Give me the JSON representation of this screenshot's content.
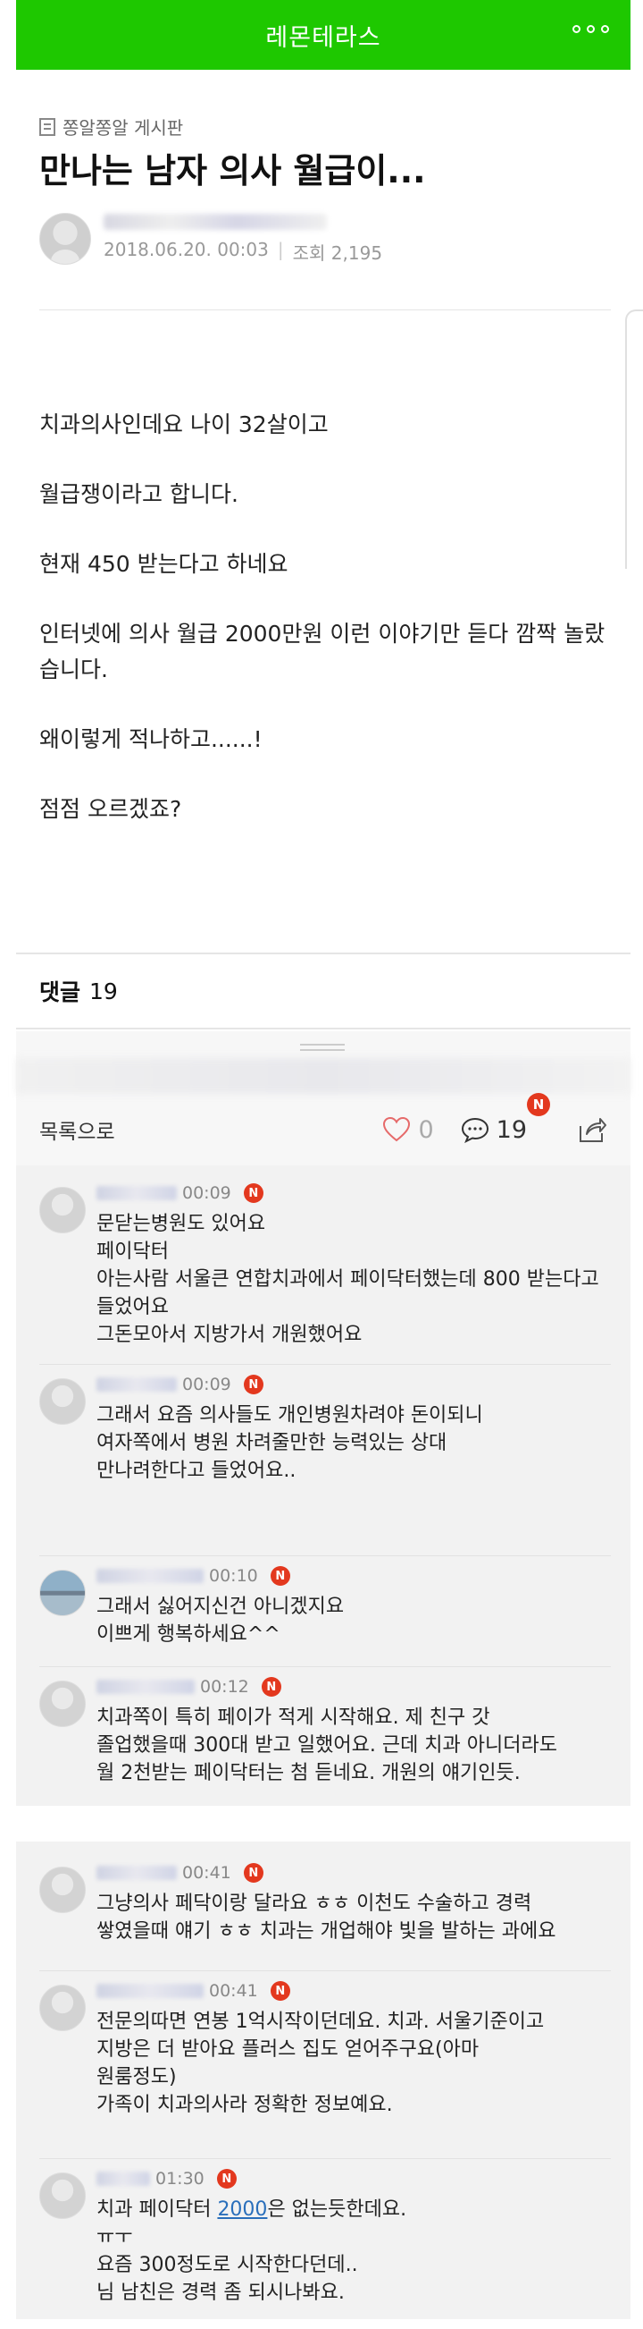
{
  "appbar": {
    "title": "레몬테라스"
  },
  "post": {
    "board": "쫑알쫑알 게시판",
    "title": "만나는 남자 의사 월급이...",
    "date": "2018.06.20. 00:03",
    "views": "조회 2,195",
    "paragraphs": [
      "치과의사인데요 나이 32살이고",
      "월급쟁이라고 합니다.",
      "현재 450 받는다고 하네요",
      "인터넷에 의사 월급 2000만원 이런 이야기만 듣다 깜짝 놀랐습니다.",
      "왜이렇게 적나하고......!",
      "점점 오르겠죠?"
    ]
  },
  "comments_header": {
    "label": "댓글",
    "count": "19"
  },
  "actions": {
    "to_list": "목록으로",
    "likes": "0",
    "comments": "19",
    "badge": "N"
  },
  "comments": [
    {
      "time": "00:09",
      "text": "문닫는병원도 있어요\n페이닥터\n아는사람 서울큰 연합치과에서 페이닥터했는데 800 받는다고\n들었어요\n그돈모아서 지방가서 개원했어요"
    },
    {
      "time": "00:09",
      "text": "그래서 요즘 의사들도 개인병원차려야 돈이되니\n여자쪽에서 병원 차려줄만한 능력있는 상대\n만나려한다고 들었어요.."
    },
    {
      "time": "00:10",
      "text": "그래서 싫어지신건 아니겠지요\n이쁘게 행복하세요^^"
    },
    {
      "time": "00:12",
      "text": "치과쪽이 특히 페이가 적게 시작해요. 제 친구 갓\n졸업했을때 300대 받고 일했어요. 근데 치과 아니더라도\n월 2천받는 페이닥터는 첨 듣네요. 개원의 얘기인듯."
    },
    {
      "time": "00:41",
      "text": "그냥의사 페닥이랑 달라요 ㅎㅎ 이천도 수술하고 경력\n쌓였을때 얘기 ㅎㅎ 치과는 개업해야 빛을 발하는 과에요"
    },
    {
      "time": "00:41",
      "text": "전문의따면 연봉 1억시작이던데요. 치과. 서울기준이고\n지방은 더 받아요 플러스 집도 얻어주구요(아마\n원룸정도)\n가족이 치과의사라 정확한 정보예요."
    },
    {
      "time": "01:30",
      "text_pre": "치과 페이닥터 ",
      "text_link": "2000",
      "text_post": "은 없는듯한데요.\nㅠㅜ\n요즘 300정도로 시작한다던데..\n님 남친은 경력 좀 되시나봐요."
    }
  ],
  "colors": {
    "brand": "#1ec800",
    "badge": "#e3381e",
    "link": "#2a6fbb"
  }
}
